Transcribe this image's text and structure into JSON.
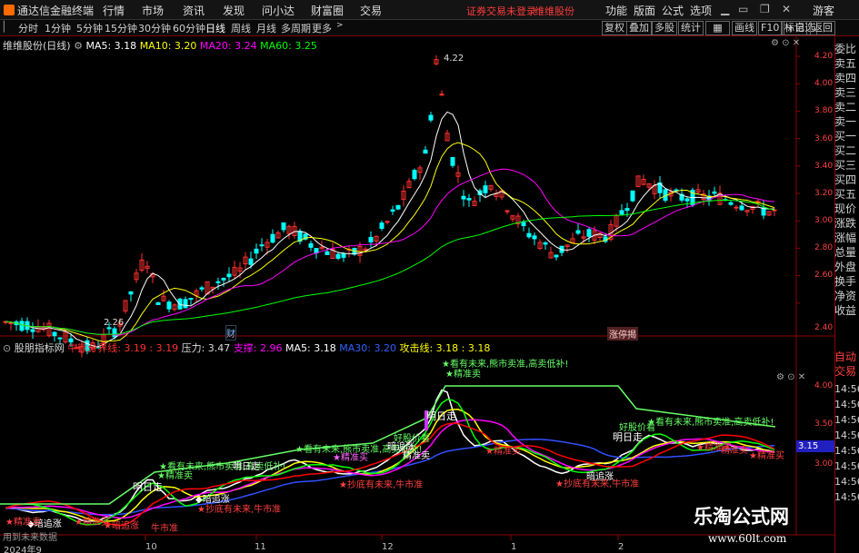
{
  "app_title": "通达信金融终端",
  "menu": [
    "行情",
    "市场",
    "资讯",
    "发现",
    "问小达",
    "财富圈",
    "交易"
  ],
  "warning": "证券交易未登录",
  "stock_name": "维维股份",
  "menu_right": [
    "功能",
    "版面",
    "公式",
    "选项"
  ],
  "guest": "游客",
  "periods": [
    "分时",
    "1分钟",
    "5分钟",
    "15分钟",
    "30分钟",
    "60分钟",
    "日线",
    "周线",
    "月线",
    "多周期",
    "更多"
  ],
  "active_period": "日线",
  "toolbar_right": [
    "复权",
    "叠加",
    "多股",
    "统计",
    "画线",
    "F10",
    "标记",
    "+自选",
    "返回"
  ],
  "price_header": {
    "name": "维维股份(日线)",
    "ma5": "MA5: 3.18",
    "ma10": "MA10: 3.20",
    "ma20": "MA20: 3.24",
    "ma60": "MA60: 3.25"
  },
  "colors": {
    "up": "#ff3030",
    "down": "#00ffff",
    "ma5": "#ffffff",
    "ma10": "#ffff00",
    "ma20": "#ff00ff",
    "ma60": "#00ff00",
    "bg": "#000000",
    "grid": "#8b0000"
  },
  "right_panel": [
    "委比",
    "卖五",
    "卖四",
    "卖三",
    "卖二",
    "卖一",
    "买一",
    "买二",
    "买三",
    "买四",
    "买五",
    "现价",
    "涨跌",
    "涨幅",
    "总量",
    "外盘",
    "换手",
    "净资",
    "收益"
  ],
  "right_panel_lower": [
    "自动",
    "交易"
  ],
  "lower_time": [
    "14:56",
    "14:56",
    "14:56",
    "14:56",
    "14:56",
    "14:56",
    "14:56",
    "14:56"
  ],
  "price_axis": [
    "4.20",
    "4.00",
    "3.80",
    "3.60",
    "3.40",
    "3.20",
    "3.00",
    "2.80",
    "2.60",
    "2.40"
  ],
  "annot_high": "4.22",
  "annot_low": "2.26",
  "marker_cai": "财",
  "marker_zt": "涨停揭",
  "ind_header": {
    "name": "股朋指标网",
    "bull": "牛熊分界线: 3.19 : 3.19",
    "press": "压力: 3.47",
    "support": "支撑: 2.96",
    "ma5": "MA5: 3.18",
    "ma30": "MA30: 3.20",
    "attack": "攻击线: 3.18 : 3.18"
  },
  "ind_axis": [
    "4.00",
    "3.50",
    "3.00"
  ],
  "ind_current": "3.15",
  "ind_labels": [
    "★精准卖",
    "明日走",
    "精准卖",
    "精准买",
    "精准买",
    "暗追涨",
    "★精准买",
    "好股价看",
    "★看有未来,熊市卖准,高卖低补!",
    "★精准买",
    "明日走",
    "精准卖",
    "★看有未来,熊市卖准,高卖低补!",
    "★精准卖",
    "★精准卖",
    "★精准买",
    "牛市准",
    "精准卖",
    "好股价看",
    "★看有未来,熊市卖准,高卖低补!",
    "★看有未来,熊市卖准,高卖低补!",
    "★精准卖",
    "明日走",
    "★精准买",
    "暗追涨",
    "★抄底有未来,牛市准",
    "明日走",
    "精准卖",
    "★精准买",
    "★抄底有未来,牛市准",
    "◆暗追涨",
    "★抄底有未来,牛市准",
    "★暗追涨",
    "牛市准",
    "◆暗追涨"
  ],
  "x_axis": [
    "2024年9",
    "10",
    "11",
    "12",
    "1",
    "2"
  ],
  "bottom_note": "用到未来数据",
  "watermark_title": "乐淘公式网",
  "watermark_url": "www.60lt.com"
}
